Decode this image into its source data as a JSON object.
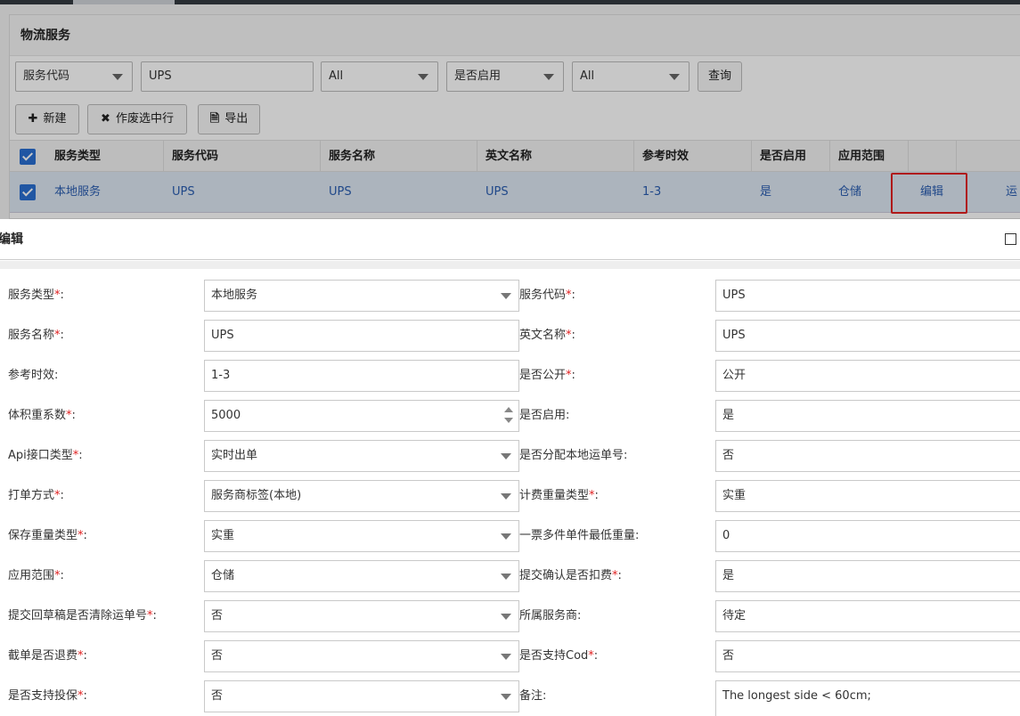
{
  "background": {
    "panel_title": "物流服务",
    "filters": {
      "field_select": "服务代码",
      "keyword_value": "UPS",
      "select_all_1": "All",
      "enabled_select": "是否启用",
      "select_all_2": "All",
      "query_label": "查询"
    },
    "toolbar": {
      "new_label": "新建",
      "void_label": "作废选中行",
      "export_label": "导出"
    },
    "grid": {
      "headers": [
        "服务类型",
        "服务代码",
        "服务名称",
        "英文名称",
        "参考时效",
        "是否启用",
        "应用范围"
      ],
      "row": {
        "service_type": "本地服务",
        "service_code": "UPS",
        "service_name": "UPS",
        "english_name": "UPS",
        "ref_time": "1-3",
        "enabled": "是",
        "scope": "仓储",
        "edit_link": "编辑",
        "extra_link": "运"
      }
    }
  },
  "dialog": {
    "title": "编辑",
    "left_fields": [
      {
        "label": "服务类型",
        "required": "*",
        "value": "本地服务",
        "kind": "select"
      },
      {
        "label": "服务名称",
        "required": "*",
        "value": "UPS",
        "kind": "input"
      },
      {
        "label": "参考时效",
        "required": "",
        "value": "1-3",
        "kind": "input"
      },
      {
        "label": "体积重系数",
        "required": "*",
        "value": "5000",
        "kind": "number"
      },
      {
        "label": "Api接口类型",
        "required": "*",
        "value": "实时出单",
        "kind": "select"
      },
      {
        "label": "打单方式",
        "required": "*",
        "value": "服务商标签(本地)",
        "kind": "select"
      },
      {
        "label": "保存重量类型",
        "required": "*",
        "value": "实重",
        "kind": "select"
      },
      {
        "label": "应用范围",
        "required": "*",
        "value": "仓储",
        "kind": "select"
      },
      {
        "label": "提交回草稿是否清除运单号",
        "required": "*",
        "value": "否",
        "kind": "select"
      },
      {
        "label": "截单是否退费",
        "required": "*",
        "value": "否",
        "kind": "select"
      },
      {
        "label": "是否支持投保",
        "required": "*",
        "value": "否",
        "kind": "select"
      }
    ],
    "right_fields": [
      {
        "label": "服务代码",
        "required": "*",
        "value": "UPS",
        "kind": "input"
      },
      {
        "label": "英文名称",
        "required": "*",
        "value": "UPS",
        "kind": "input"
      },
      {
        "label": "是否公开",
        "required": "*",
        "value": "公开",
        "kind": "select"
      },
      {
        "label": "是否启用",
        "required": "",
        "value": "是",
        "kind": "select"
      },
      {
        "label": "是否分配本地运单号",
        "required": "",
        "value": "否",
        "kind": "select"
      },
      {
        "label": "计费重量类型",
        "required": "*",
        "value": "实重",
        "kind": "select"
      },
      {
        "label": "一票多件单件最低重量",
        "required": "",
        "value": "0",
        "kind": "input"
      },
      {
        "label": "提交确认是否扣费",
        "required": "*",
        "value": "是",
        "kind": "select"
      },
      {
        "label": "所属服务商",
        "required": "",
        "value": "待定",
        "kind": "select"
      },
      {
        "label": "是否支持Cod",
        "required": "*",
        "value": "否",
        "kind": "select"
      },
      {
        "label": "备注",
        "required": "",
        "value": "The longest side < 60cm;",
        "kind": "textarea"
      }
    ]
  }
}
